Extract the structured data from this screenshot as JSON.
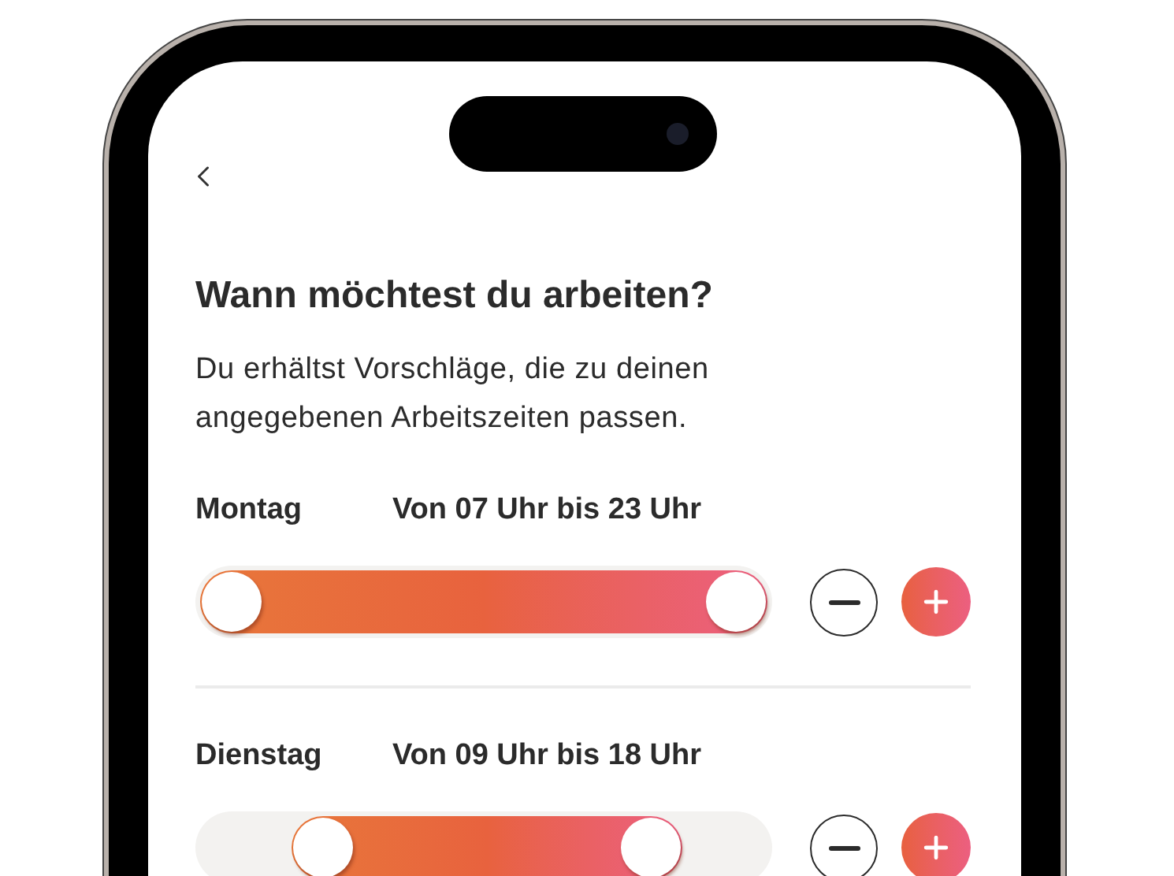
{
  "screen": {
    "title": "Wann möchtest du arbeiten?",
    "subtitle": "Du erhältst Vorschläge, die zu deinen angegebenen Arbeitszeiten passen.",
    "days": [
      {
        "day": "Montag",
        "range": "Von 07 Uhr bis 23 Uhr",
        "start": {
          "level": 0
        }
      },
      {
        "day": "Dienstag",
        "range": "Von 09 Uhr bis 18 Uhr",
        "start": {
          "level": 0.16
        }
      }
    ]
  }
}
